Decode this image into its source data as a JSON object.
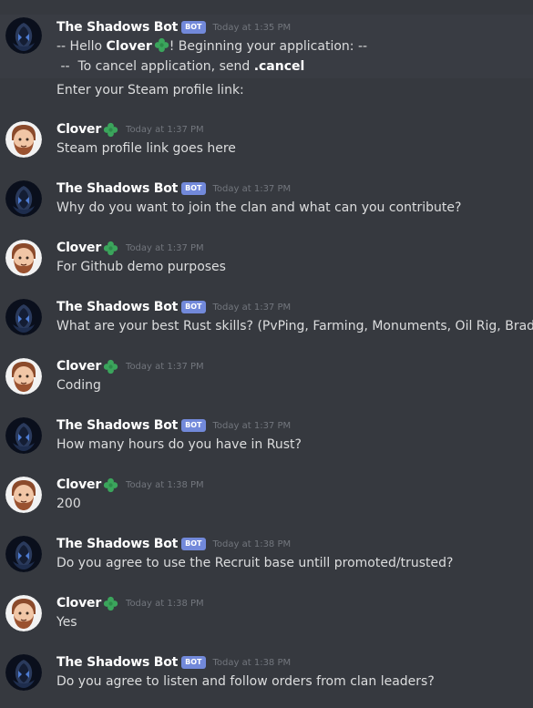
{
  "colors": {
    "background": "#36393f",
    "username": "#ffffff",
    "bot_tag": "#7289da",
    "timestamp": "#72767d",
    "message_text": "#dcddde",
    "clover_green": "#3ba55c"
  },
  "icons": {
    "bot_avatar": "dark-hooded-avatar",
    "user_avatar": "bearded-man-avatar",
    "clover": "four-leaf-clover-icon"
  },
  "messages": [
    {
      "author": "The Shadows Bot",
      "bot_tag": "BOT",
      "time": "Today at 1:35 PM",
      "intro_1_a": "--  Hello ",
      "intro_1_b": "Clover",
      "intro_1_c": "! Beginning your application:  --",
      "intro_2_a": " --  To cancel application, send ",
      "intro_2_b": ".cancel",
      "line_3": "Enter your Steam profile link:"
    },
    {
      "author": "Clover",
      "time": "Today at 1:37 PM",
      "text": "Steam profile link goes here"
    },
    {
      "author": "The Shadows Bot",
      "bot_tag": "BOT",
      "time": "Today at 1:37 PM",
      "text": "Why do you want to join the clan and what can you contribute?"
    },
    {
      "author": "Clover",
      "time": "Today at 1:37 PM",
      "text": "For Github demo purposes"
    },
    {
      "author": "The Shadows Bot",
      "bot_tag": "BOT",
      "time": "Today at 1:37 PM",
      "text": "What are your best Rust skills? (PvPing, Farming, Monuments, Oil Rig, Bradley)"
    },
    {
      "author": "Clover",
      "time": "Today at 1:37 PM",
      "text": "Coding"
    },
    {
      "author": "The Shadows Bot",
      "bot_tag": "BOT",
      "time": "Today at 1:37 PM",
      "text": "How many hours do you have in Rust?"
    },
    {
      "author": "Clover",
      "time": "Today at 1:38 PM",
      "text": "200"
    },
    {
      "author": "The Shadows Bot",
      "bot_tag": "BOT",
      "time": "Today at 1:38 PM",
      "text": "Do you agree to use the Recruit base untill promoted/trusted?"
    },
    {
      "author": "Clover",
      "time": "Today at 1:38 PM",
      "text": "Yes"
    },
    {
      "author": "The Shadows Bot",
      "bot_tag": "BOT",
      "time": "Today at 1:38 PM",
      "text": "Do you agree to listen and follow orders from clan leaders?"
    }
  ]
}
